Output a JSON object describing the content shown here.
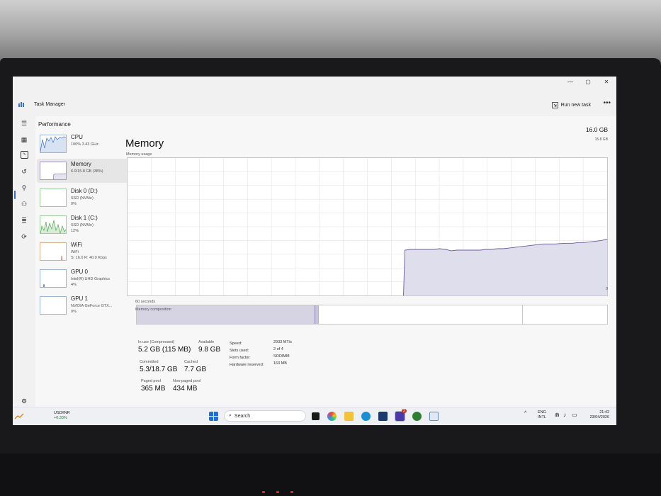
{
  "window": {
    "title": "Task Manager",
    "run_new_task": "Run new task",
    "more": "•••",
    "minimize": "—",
    "maximize": "▢",
    "close": "✕"
  },
  "sidebar": {
    "header": "Performance"
  },
  "devices": [
    {
      "name": "CPU",
      "line1": "100% 3.43 GHz",
      "line2": ""
    },
    {
      "name": "Memory",
      "line1": "6.0/15.8 GB (38%)",
      "line2": ""
    },
    {
      "name": "Disk 0 (D:)",
      "line1": "SSD (NVMe)",
      "line2": "0%"
    },
    {
      "name": "Disk 1 (C:)",
      "line1": "SSD (NVMe)",
      "line2": "12%"
    },
    {
      "name": "WiFi",
      "line1": "WiFi",
      "line2": "S: 16.0 R: 40.0 Kbps"
    },
    {
      "name": "GPU 0",
      "line1": "Intel(R) UHD Graphics",
      "line2": "4%"
    },
    {
      "name": "GPU 1",
      "line1": "NVIDIA GeForce GTX...",
      "line2": "0%"
    }
  ],
  "memory": {
    "title": "Memory",
    "total": "16.0 GB",
    "usage_label": "Memory usage",
    "max_label": "15.8 GB",
    "zero_label": "0",
    "time_label": "60 seconds",
    "composition_label": "Memory composition",
    "in_use_label": "In use (Compressed)",
    "in_use_value": "5.2 GB (115 MB)",
    "available_label": "Available",
    "available_value": "9.8 GB",
    "committed_label": "Committed",
    "committed_value": "5.3/18.7 GB",
    "cached_label": "Cached",
    "cached_value": "7.7 GB",
    "paged_label": "Paged pool",
    "paged_value": "365 MB",
    "nonpaged_label": "Non-paged pool",
    "nonpaged_value": "434 MB",
    "hw": [
      {
        "label": "Speed:",
        "value": "2933 MT/s"
      },
      {
        "label": "Slots used:",
        "value": "2 of 4"
      },
      {
        "label": "Form factor:",
        "value": "SODIMM"
      },
      {
        "label": "Hardware reserved:",
        "value": "163 MB"
      }
    ],
    "usage_series_pct": [
      0,
      0,
      0,
      0,
      0,
      0,
      0,
      0,
      0,
      0,
      0,
      0,
      0,
      0,
      0,
      0,
      0,
      0,
      0,
      0,
      0,
      0,
      0,
      0,
      0,
      0,
      0,
      0,
      0,
      0,
      0,
      0,
      0,
      0,
      0,
      0,
      0,
      0,
      0,
      0,
      0,
      0,
      0,
      0,
      0,
      0,
      0,
      0,
      33,
      33.5,
      33.5,
      33.5,
      33.5,
      33.5,
      34,
      33.5,
      32.5,
      33,
      33,
      33,
      33,
      33,
      33.5,
      33.5,
      34,
      34,
      34.5,
      35,
      35.5,
      36,
      36.5,
      37,
      37.5,
      37.5,
      37.5,
      37.8,
      38,
      38,
      38.5,
      38.5,
      39,
      39.5,
      40,
      41
    ],
    "composition": {
      "in_use_fraction": 0.38,
      "modified_fraction": 0.005,
      "standby_fraction": 0.435,
      "free_fraction": 0.18
    }
  },
  "taskbar": {
    "stock_name": "USD/INR",
    "stock_change": "+0.33%",
    "search_placeholder": "Search",
    "lang1": "ENG",
    "lang2": "INTL",
    "time": "21:42",
    "date": "23/04/2026",
    "badge": "2"
  },
  "colors": {
    "accent": "#2b6cd6",
    "memory_line": "#6b5a9a",
    "memory_fill": "#dfdeed",
    "chart_grid": "#e4e4e4"
  }
}
